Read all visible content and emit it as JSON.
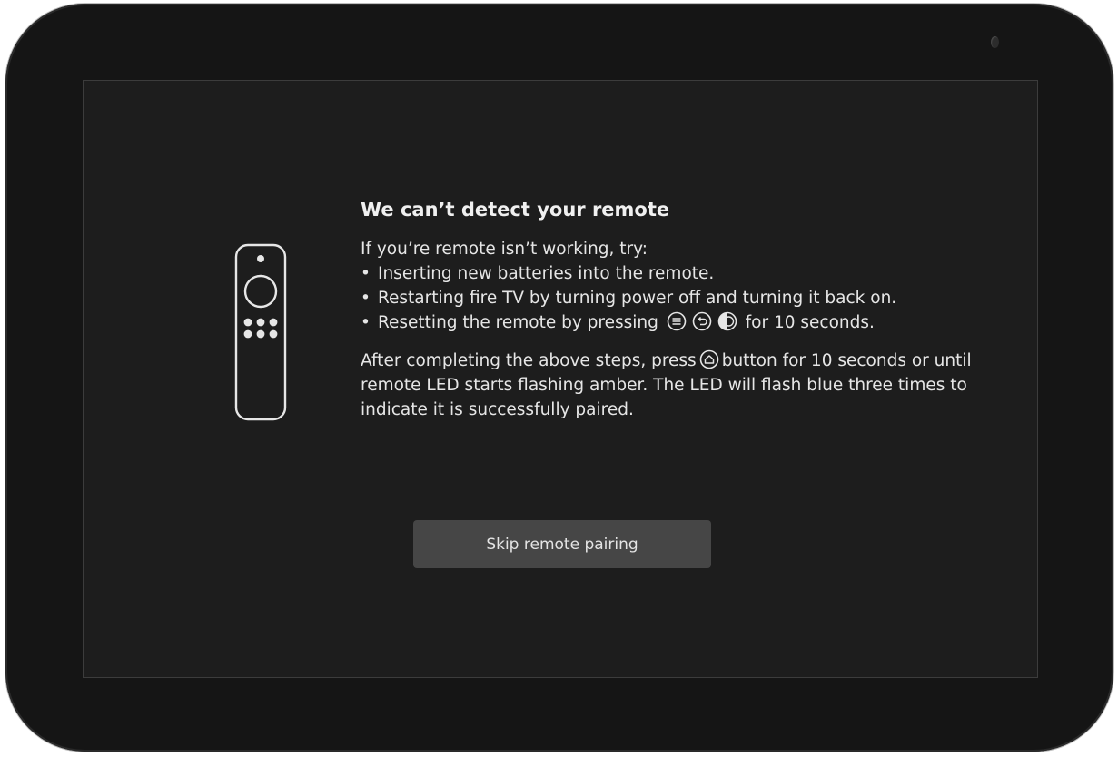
{
  "screen": {
    "title": "We can’t detect your remote",
    "intro": "If you’re remote isn’t working, try:",
    "bullet_char": "•",
    "steps": [
      {
        "text": "Inserting new batteries into the remote."
      },
      {
        "text": "Restarting fire TV by turning power off and turning it back on."
      },
      {
        "text_before": "Resetting the remote by pressing",
        "icons": [
          "menu-button-icon",
          "back-button-icon",
          "left-button-icon"
        ],
        "text_after": "for 10 seconds."
      }
    ],
    "paragraph_before": "After completing the above steps, press",
    "paragraph_icon": "home-button-icon",
    "paragraph_after": "button for 10 seconds or until remote LED starts flashing amber.  The LED will flash blue three times to indicate it is successfully paired.",
    "skip_button_label": "Skip remote pairing"
  },
  "colors": {
    "bezel": "#151515",
    "screen_background": "#1d1d1d",
    "text": "#ececec",
    "button_background": "#464646"
  },
  "icons": {
    "remote": "fire-tv-remote-icon",
    "camera": "camera-icon"
  }
}
